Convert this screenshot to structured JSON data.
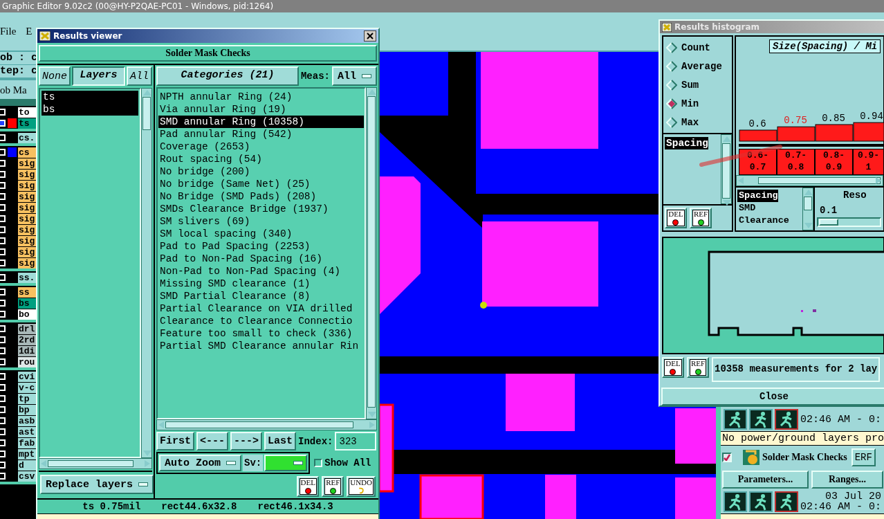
{
  "app": {
    "title": "Graphic Editor 9.02c2 (00@HY-P2QAE-PC01 - Windows, pid:1264)",
    "menu": [
      {
        "label": "File"
      },
      {
        "label": "E"
      }
    ],
    "job_field": "ob : c",
    "step_field": "tep: c",
    "layer_header": "ob Ma",
    "layer_groups": [
      [
        {
          "name": "to",
          "kind": "paper",
          "selected": false
        },
        {
          "name": "ts",
          "kind": "mask",
          "color": "#ff0000",
          "selected": true
        }
      ],
      [
        {
          "name": "cs.",
          "kind": "doc",
          "selected": false
        }
      ],
      [
        {
          "name": "cs",
          "kind": "signal",
          "color": "#0000ff",
          "selected": false
        },
        {
          "name": "sig",
          "kind": "signal",
          "selected": false
        },
        {
          "name": "sig",
          "kind": "signal",
          "selected": false
        },
        {
          "name": "sig",
          "kind": "signal",
          "selected": false
        },
        {
          "name": "sig",
          "kind": "signal",
          "selected": false
        },
        {
          "name": "sig",
          "kind": "signal",
          "selected": false
        },
        {
          "name": "sig",
          "kind": "signal",
          "selected": false
        },
        {
          "name": "sig",
          "kind": "signal",
          "selected": false
        },
        {
          "name": "sig",
          "kind": "signal",
          "selected": false
        },
        {
          "name": "sig",
          "kind": "signal",
          "selected": false
        },
        {
          "name": "sig",
          "kind": "signal",
          "selected": false
        }
      ],
      [
        {
          "name": "ss.",
          "kind": "doc",
          "selected": false
        }
      ],
      [
        {
          "name": "ss",
          "kind": "signal",
          "selected": false
        },
        {
          "name": "bs",
          "kind": "mask",
          "selected": false
        },
        {
          "name": "bo",
          "kind": "paper",
          "selected": false
        }
      ],
      [
        {
          "name": "drl",
          "kind": "drill",
          "selected": false
        },
        {
          "name": "2rd",
          "kind": "drill",
          "selected": false
        },
        {
          "name": "1di",
          "kind": "drill",
          "selected": false
        },
        {
          "name": "rou",
          "kind": "rout",
          "selected": false
        }
      ],
      [
        {
          "name": "cvi",
          "kind": "doc",
          "selected": false
        },
        {
          "name": "v-c",
          "kind": "doc",
          "selected": false
        },
        {
          "name": "tp",
          "kind": "doc",
          "selected": false
        },
        {
          "name": "bp",
          "kind": "doc",
          "selected": false
        },
        {
          "name": "asb",
          "kind": "doc",
          "selected": false
        },
        {
          "name": "ast",
          "kind": "doc",
          "selected": false
        },
        {
          "name": "fab",
          "kind": "doc",
          "selected": false
        },
        {
          "name": "mpt",
          "kind": "doc",
          "selected": false
        },
        {
          "name": "d",
          "kind": "doc",
          "selected": false
        },
        {
          "name": "csv",
          "kind": "doc",
          "selected": false
        }
      ]
    ]
  },
  "results_viewer": {
    "title": "Results viewer",
    "check_name": "Solder Mask Checks",
    "none_button": "None",
    "layers_title": "Layers",
    "all_button": "All",
    "layers": [
      {
        "name": "ts",
        "selected": true
      },
      {
        "name": "bs",
        "selected": true
      }
    ],
    "categories_title": "Categories (21)",
    "meas_label": "Meas:",
    "meas_value": "All",
    "categories": [
      {
        "label": "NPTH annular Ring (24)",
        "selected": false
      },
      {
        "label": "Via annular Ring (19)",
        "selected": false
      },
      {
        "label": "SMD annular Ring (10358)",
        "selected": true
      },
      {
        "label": "Pad annular Ring (542)",
        "selected": false
      },
      {
        "label": "Coverage (2653)",
        "selected": false
      },
      {
        "label": "Rout spacing (54)",
        "selected": false
      },
      {
        "label": "No bridge (200)",
        "selected": false
      },
      {
        "label": "No bridge (Same Net) (25)",
        "selected": false
      },
      {
        "label": "No Bridge (SMD Pads) (208)",
        "selected": false
      },
      {
        "label": "SMDs Clearance Bridge (1937)",
        "selected": false
      },
      {
        "label": "SM slivers (69)",
        "selected": false
      },
      {
        "label": "SM local spacing (340)",
        "selected": false
      },
      {
        "label": "Pad to Pad Spacing (2253)",
        "selected": false
      },
      {
        "label": "Pad to Non-Pad Spacing (16)",
        "selected": false
      },
      {
        "label": "Non-Pad to Non-Pad Spacing (4)",
        "selected": false
      },
      {
        "label": "Missing SMD clearance (1)",
        "selected": false
      },
      {
        "label": "SMD Partial Clearance (8)",
        "selected": false
      },
      {
        "label": "Partial Clearance on VIA drilled",
        "selected": false
      },
      {
        "label": "Clearance to Clearance Connectio",
        "selected": false
      },
      {
        "label": "Feature too small to check (336)",
        "selected": false
      },
      {
        "label": "Partial SMD Clearance annular Rin",
        "selected": false
      }
    ],
    "nav_buttons": [
      "First",
      "<---",
      "--->",
      "Last"
    ],
    "index_label": "Index:",
    "index_value": "323",
    "zoom_mode": "Auto Zoom",
    "sv_label": "Sv:",
    "show_all": {
      "label": "Show All",
      "checked": false
    },
    "layer_mode": "Replace layers",
    "tool_buttons": [
      {
        "label": "DEL",
        "kind": "delete"
      },
      {
        "label": "REF",
        "kind": "refresh"
      },
      {
        "label": "UNDO",
        "kind": "undo"
      }
    ],
    "status": [
      "ts 0.75mil",
      "rect44.6x32.8",
      "rect46.1x34.3"
    ]
  },
  "histogram": {
    "title": "Results histogram",
    "modes": [
      {
        "label": "Count",
        "selected": false
      },
      {
        "label": "Average",
        "selected": false
      },
      {
        "label": "Sum",
        "selected": false
      },
      {
        "label": "Min",
        "selected": true
      },
      {
        "label": "Max",
        "selected": false
      }
    ],
    "measures": [
      {
        "label": "Spacing",
        "selected": true
      }
    ],
    "left_buttons": [
      {
        "label": "DEL",
        "kind": "delete"
      },
      {
        "label": "REF",
        "kind": "refresh"
      }
    ],
    "chart_title": "Size(Spacing) / Mi",
    "bins": [
      {
        "selected": false
      },
      {
        "selected": true
      },
      {
        "selected": false
      },
      {
        "selected": false
      }
    ],
    "chart_data": {
      "type": "bar",
      "categories": [
        "0.6-0.7",
        "0.7-0.8",
        "0.8-0.9",
        "0.9-1"
      ],
      "values": [
        0.6,
        0.75,
        0.85,
        0.94
      ],
      "data_labels": true
    },
    "fields": [
      {
        "label": "Spacing",
        "selected": true
      },
      {
        "label": "SMD",
        "selected": false
      },
      {
        "label": "Clearance",
        "selected": false
      }
    ],
    "resolution_label": "Reso",
    "resolution_value": "0.1",
    "buttons": [
      {
        "label": "DEL",
        "kind": "delete"
      },
      {
        "label": "REF",
        "kind": "refresh"
      }
    ],
    "summary": "10358 measurements for 2 lay",
    "close": "Close"
  },
  "action_panel": {
    "rows": [
      {
        "kind": "run",
        "time": "02:46 AM - 0:"
      },
      {
        "kind": "message",
        "text": "No power/ground layers pro"
      },
      {
        "kind": "check",
        "label": "Solder Mask Checks",
        "checked": true,
        "button": "ERF"
      },
      {
        "kind": "buttons",
        "labels": [
          "Parameters...",
          "Ranges..."
        ]
      },
      {
        "kind": "run",
        "date": "03 Jul 20",
        "time": "02:46 AM - 0:"
      }
    ]
  }
}
